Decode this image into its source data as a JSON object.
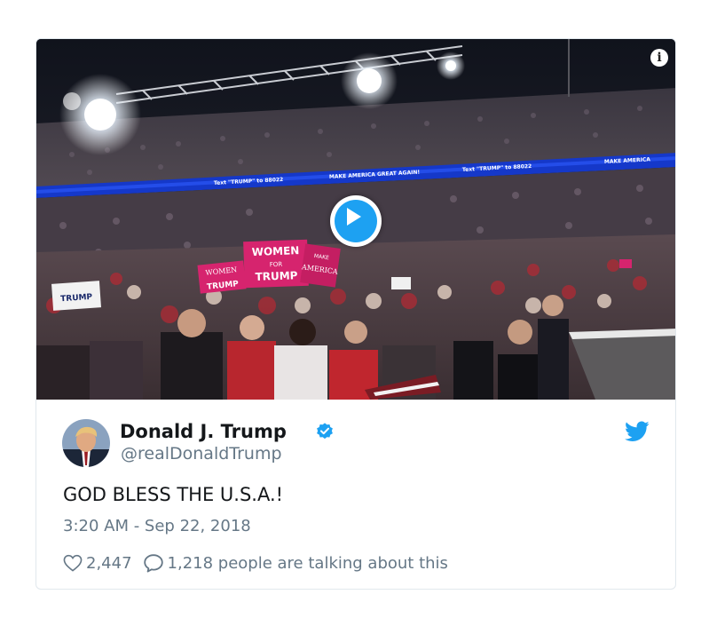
{
  "tweet": {
    "author_name": "Donald J. Trump",
    "author_handle": "@realDonaldTrump",
    "text": "GOD BLESS THE U.S.A.!",
    "timestamp": "3:20 AM - Sep 22, 2018",
    "likes": "2,447",
    "talking": "1,218 people are talking about this",
    "verified": true
  },
  "media": {
    "type": "video",
    "info_icon": "i",
    "signs": {
      "women": "WOMEN",
      "for": "FOR",
      "trump": "TRUMP",
      "trump_left": "TRUMP",
      "make": "MAKE",
      "america": "AMERICA"
    },
    "ribbon_text": [
      "Text \"TRUMP\" to 88022",
      "MAKE AMERICA GREAT AGAIN!",
      "MAKE AMERICA"
    ]
  },
  "icons": {
    "play": "play-icon",
    "info": "info-icon",
    "verified": "verified-badge-icon",
    "brand": "twitter-bird-icon",
    "like": "heart-icon",
    "reply": "speech-bubble-icon"
  },
  "colors": {
    "twitter_blue": "#1da1f2",
    "text_primary": "#14171a",
    "text_secondary": "#657786",
    "border": "#e1e8ed",
    "sign_pink": "#d6246e"
  }
}
